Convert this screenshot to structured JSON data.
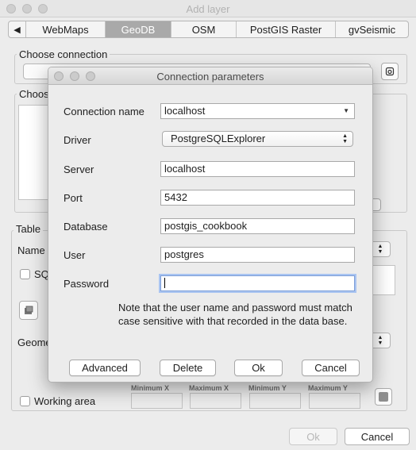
{
  "window": {
    "title": "Add layer"
  },
  "tabs": [
    {
      "label": "WebMaps"
    },
    {
      "label": "GeoDB",
      "active": true
    },
    {
      "label": "OSM"
    },
    {
      "label": "PostGIS Raster"
    },
    {
      "label": "gvSeismic"
    }
  ],
  "background": {
    "choose_connection_group": "Choose connection",
    "choose_group_partial": "Choos",
    "table_group_partial": "Table",
    "name_label_partial": "Name",
    "sql_label_partial": "SQ",
    "geometry_label_partial": "Geome",
    "working_area_label": "Working area",
    "minmax_headers": [
      "Minimum X",
      "Maximum X",
      "Minimum Y",
      "Maximum Y"
    ],
    "ok_button": "Ok",
    "cancel_button": "Cancel"
  },
  "dialog": {
    "title": "Connection parameters",
    "fields": {
      "connection_name": {
        "label": "Connection name",
        "value": "localhost"
      },
      "driver": {
        "label": "Driver",
        "value": "PostgreSQLExplorer"
      },
      "server": {
        "label": "Server",
        "value": "localhost"
      },
      "port": {
        "label": "Port",
        "value": "5432"
      },
      "database": {
        "label": "Database",
        "value": "postgis_cookbook"
      },
      "user": {
        "label": "User",
        "value": "postgres"
      },
      "password": {
        "label": "Password",
        "value": ""
      }
    },
    "note": "Note that the user name and password must match case sensitive with that recorded in the data base.",
    "buttons": {
      "advanced": "Advanced",
      "delete": "Delete",
      "ok": "Ok",
      "cancel": "Cancel"
    }
  },
  "colors": {
    "active_tab": "#a9a9a9",
    "focus_ring": "#a9c4f1"
  }
}
